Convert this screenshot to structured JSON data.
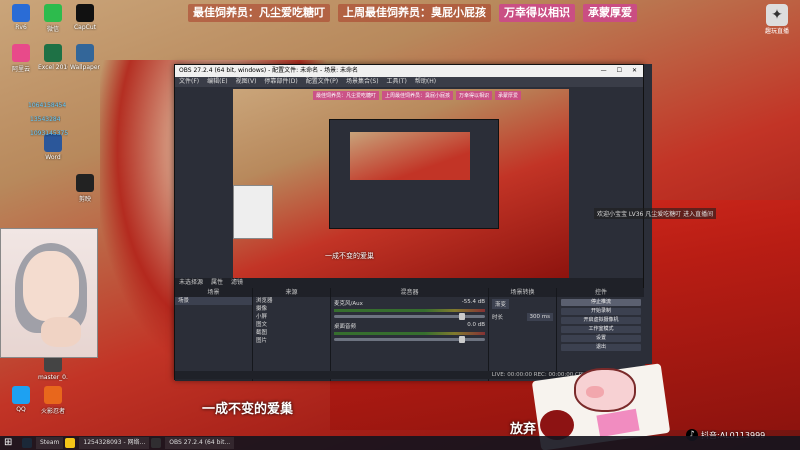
{
  "banner": {
    "items": [
      "最佳饲养员：凡尘爱吃糖叮",
      "上周最佳饲养员：臭屁小屁孩",
      "万幸得以相识",
      "承蒙厚爱"
    ]
  },
  "top_right_badge": "趣玩直播",
  "desktop_icons": [
    {
      "label": "Rv6"
    },
    {
      "label": "微信"
    },
    {
      "label": "CapCut"
    },
    {
      "label": "阿里云"
    },
    {
      "label": "Excel 2016"
    },
    {
      "label": "Wallpaper"
    },
    {
      "label": "Word"
    },
    {
      "label": "剪映"
    },
    {
      "label": "QQ"
    },
    {
      "label": "master_0..."
    },
    {
      "label": "火影忍者"
    }
  ],
  "desktop_numbers": [
    "1064158454",
    "13543284",
    "1093145375"
  ],
  "obs": {
    "title": "OBS 27.2.4 (64 bit, windows) - 配置文件: 未命名 - 场景: 未命名",
    "menu": [
      "文件(F)",
      "编辑(E)",
      "视图(V)",
      "停靠部件(D)",
      "配置文件(P)",
      "场景集合(S)",
      "工具(T)",
      "帮助(H)"
    ],
    "preview_caption": "一成不变的爱巢",
    "docks_header": [
      "未选择源",
      "属性",
      "滤镜"
    ],
    "scenes": {
      "title": "场景",
      "items": [
        "场景"
      ]
    },
    "sources": {
      "title": "来源",
      "items": [
        "浏览器",
        "摄像",
        "小屏",
        "图文",
        "截图",
        "图片"
      ]
    },
    "mixer": {
      "title": "混音器",
      "channels": [
        {
          "name": "麦克风/Aux",
          "db": "-55.4 dB"
        },
        {
          "name": "桌面音频",
          "db": "0.0 dB"
        }
      ]
    },
    "transitions": {
      "title": "场景转换",
      "type": "渐变",
      "duration_label": "时长",
      "duration": "300 ms"
    },
    "controls": {
      "title": "控件",
      "buttons": [
        "停止推流",
        "开始录制",
        "开启虚拟摄像机",
        "工作室模式",
        "设置",
        "退出"
      ]
    },
    "status": "LIVE: 00:00:00   REC: 00:00:00   CPU: 1.2%, 30.00 fps"
  },
  "chat_line": "欢迎小宝宝 LV36 凡尘爱吃糖叮 进入直播间",
  "caption": "一成不变的爱巢",
  "caption_right": "放弃",
  "taskbar": {
    "tasks": [
      "Steam",
      "1254328093 - 网络...",
      "OBS 27.2.4 (64 bit..."
    ]
  },
  "tiktok": {
    "label": "抖音:AL0113999"
  },
  "colors": {
    "accent_pink": "#cd468c",
    "obs_bg": "#2b2e38",
    "red_cloth": "#c23426"
  }
}
